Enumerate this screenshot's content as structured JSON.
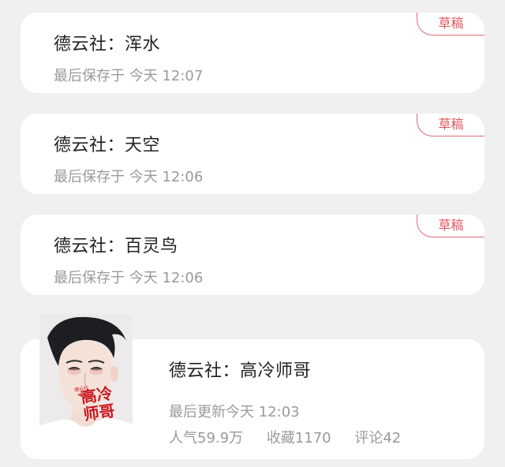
{
  "drafts": [
    {
      "title": "德云社：浑水",
      "saved": "最后保存于 今天 12:07",
      "badge": "草稿"
    },
    {
      "title": "德云社：天空",
      "saved": "最后保存于 今天 12:06",
      "badge": "草稿"
    },
    {
      "title": "德云社：百灵鸟",
      "saved": "最后保存于 今天 12:06",
      "badge": "草稿"
    }
  ],
  "book": {
    "title": "德云社：高冷师哥",
    "updated": "最后更新今天 12:03",
    "popularity": "人气59.9万",
    "favorites": "收藏1170",
    "comments": "评论42",
    "cover_text": "高冷\n师哥",
    "cover_small_text": "德云社"
  },
  "colors": {
    "background": "#f0f0f0",
    "card": "#ffffff",
    "badge_red": "#e05660",
    "cover_title_red": "#c8161d"
  }
}
